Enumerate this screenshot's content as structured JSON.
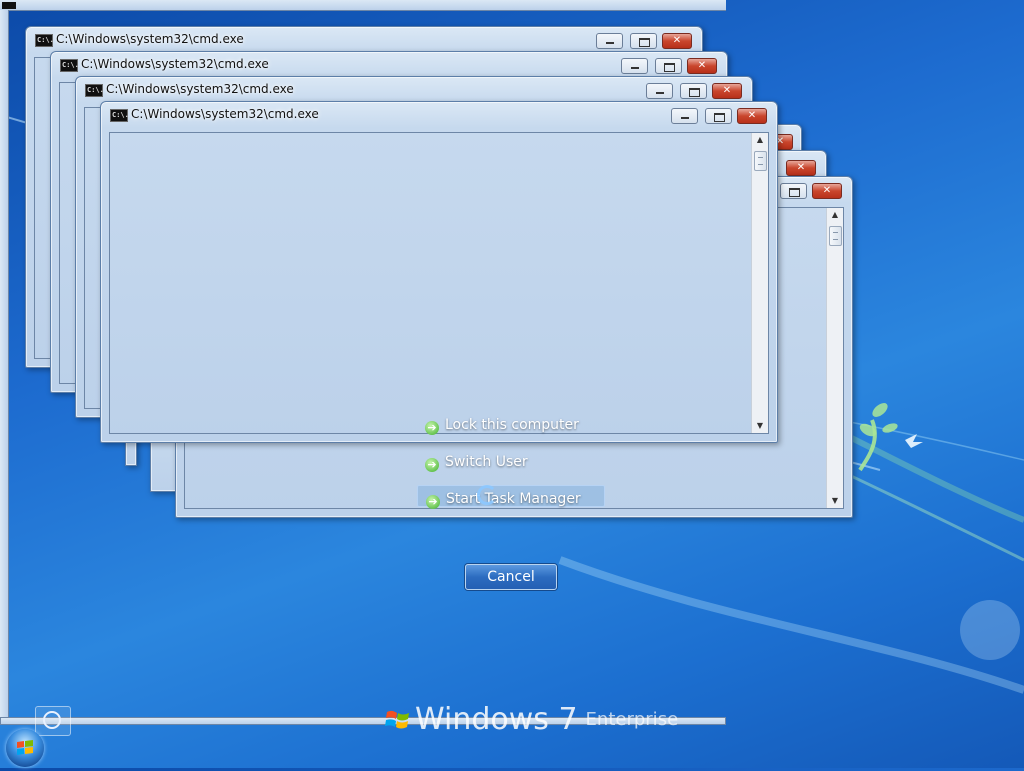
{
  "window": {
    "title": "C:\\Windows\\system32\\cmd.exe",
    "icon_text": "C:\\."
  },
  "security_options": {
    "lock": "Lock this computer",
    "switch_user": "Switch User",
    "task_manager": "Start Task Manager",
    "cancel": "Cancel"
  },
  "branding": {
    "product": "Windows 7",
    "edition": "Enterprise"
  },
  "icons": {
    "option_arrow": "arrow-right-icon",
    "ease_of_access": "ease-of-access-icon",
    "start_orb": "windows-orb-icon",
    "busy": "busy-spinner-icon"
  },
  "colors": {
    "desktop_blue": "#1d6bcf",
    "close_red": "#c9452c",
    "option_green": "#3fb02a"
  }
}
